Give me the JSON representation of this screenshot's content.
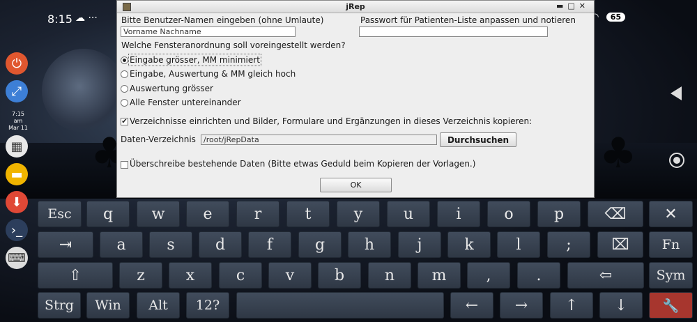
{
  "status_bar": {
    "time": "8:15",
    "icons": "☁ ···",
    "right_icons": "📶",
    "battery": "65"
  },
  "dock": {
    "items": [
      {
        "name": "power-icon",
        "glyph": "⏻",
        "color": "#e0572f"
      },
      {
        "name": "fullscreen-icon",
        "glyph": "⤢",
        "color": "#3d7fd6"
      },
      {
        "name": "apps-grid-icon",
        "glyph": "▦",
        "color": "#e8e8e8"
      },
      {
        "name": "folder-icon",
        "glyph": "▬",
        "color": "#f0b400"
      },
      {
        "name": "download-icon",
        "glyph": "⬇",
        "color": "#e04836"
      },
      {
        "name": "terminal-icon",
        "glyph": "›_",
        "color": "#2c3e5c"
      },
      {
        "name": "keyboard-icon",
        "glyph": "⌨",
        "color": "#dddddd"
      }
    ],
    "mini_clock": {
      "time": "7:15",
      "ampm": "am",
      "date": "Mar 11"
    }
  },
  "window": {
    "title": "jRep",
    "username_label": "Bitte Benutzer-Namen eingeben (ohne Umlaute)",
    "username_value": "Vorname Nachname",
    "password_label": "Passwort für Patienten-Liste anpassen und notieren",
    "password_value": "",
    "layout_question": "Welche Fensteranordnung soll voreingestellt werden?",
    "layout_options": [
      "Eingabe grösser, MM minimiert",
      "Eingabe, Auswertung & MM gleich hoch",
      "Auswertung grösser",
      "Alle Fenster untereinander"
    ],
    "selected_layout": 0,
    "copy_dirs_label": "Verzeichnisse einrichten und Bilder, Formulare und Ergänzungen in dieses Verzeichnis kopieren:",
    "copy_dirs_checked": true,
    "data_dir_label": "Daten-Verzeichnis",
    "data_dir_value": "/root/jRepData",
    "browse_button": "Durchsuchen",
    "overwrite_label": "Überschreibe bestehende Daten  (Bitte etwas Geduld beim Kopieren der Vorlagen.)",
    "overwrite_checked": false,
    "ok_button": "OK"
  },
  "keyboard": {
    "rows": [
      [
        "Esc",
        "q",
        "w",
        "e",
        "r",
        "t",
        "y",
        "u",
        "i",
        "o",
        "p",
        "⌫",
        "✕"
      ],
      [
        "⇥",
        "a",
        "s",
        "d",
        "f",
        "g",
        "h",
        "j",
        "k",
        "l",
        ";",
        "⌧",
        "Fn"
      ],
      [
        "⇧",
        "z",
        "x",
        "c",
        "v",
        "b",
        "n",
        "m",
        ",",
        ".",
        "⇦",
        "Sym"
      ],
      [
        "Strg",
        "Win",
        "Alt",
        "12?",
        " ",
        "←",
        "→",
        "↑",
        "↓",
        "🔧"
      ]
    ]
  }
}
